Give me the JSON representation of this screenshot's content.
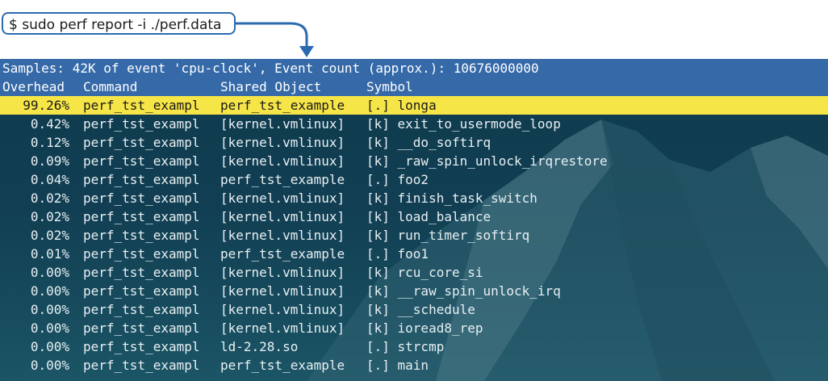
{
  "command": "$ sudo perf report -i ./perf.data",
  "summary": "Samples: 42K of event 'cpu-clock', Event count (approx.): 10676000000",
  "columns": {
    "overhead": "Overhead",
    "command": "Command",
    "object": "Shared Object",
    "symbol": "Symbol"
  },
  "colors": {
    "header_bg": "#3569a8",
    "selected_bg": "#f6e547",
    "arrow": "#2a6bb0",
    "terminal_bg": "#113e52"
  },
  "rows": [
    {
      "overhead": "99.26%",
      "command": "perf_tst_exampl",
      "object": "perf_tst_example",
      "symbol": "[.] longa",
      "selected": true
    },
    {
      "overhead": "0.42%",
      "command": "perf_tst_exampl",
      "object": "[kernel.vmlinux]",
      "symbol": "[k] exit_to_usermode_loop"
    },
    {
      "overhead": "0.12%",
      "command": "perf_tst_exampl",
      "object": "[kernel.vmlinux]",
      "symbol": "[k] __do_softirq"
    },
    {
      "overhead": "0.09%",
      "command": "perf_tst_exampl",
      "object": "[kernel.vmlinux]",
      "symbol": "[k] _raw_spin_unlock_irqrestore"
    },
    {
      "overhead": "0.04%",
      "command": "perf_tst_exampl",
      "object": "perf_tst_example",
      "symbol": "[.] foo2"
    },
    {
      "overhead": "0.02%",
      "command": "perf_tst_exampl",
      "object": "[kernel.vmlinux]",
      "symbol": "[k] finish_task_switch"
    },
    {
      "overhead": "0.02%",
      "command": "perf_tst_exampl",
      "object": "[kernel.vmlinux]",
      "symbol": "[k] load_balance"
    },
    {
      "overhead": "0.02%",
      "command": "perf_tst_exampl",
      "object": "[kernel.vmlinux]",
      "symbol": "[k] run_timer_softirq"
    },
    {
      "overhead": "0.01%",
      "command": "perf_tst_exampl",
      "object": "perf_tst_example",
      "symbol": "[.] foo1"
    },
    {
      "overhead": "0.00%",
      "command": "perf_tst_exampl",
      "object": "[kernel.vmlinux]",
      "symbol": "[k] rcu_core_si"
    },
    {
      "overhead": "0.00%",
      "command": "perf_tst_exampl",
      "object": "[kernel.vmlinux]",
      "symbol": "[k] __raw_spin_unlock_irq"
    },
    {
      "overhead": "0.00%",
      "command": "perf_tst_exampl",
      "object": "[kernel.vmlinux]",
      "symbol": "[k] __schedule"
    },
    {
      "overhead": "0.00%",
      "command": "perf_tst_exampl",
      "object": "[kernel.vmlinux]",
      "symbol": "[k] ioread8_rep"
    },
    {
      "overhead": "0.00%",
      "command": "perf_tst_exampl",
      "object": "ld-2.28.so",
      "symbol": "[.] strcmp"
    },
    {
      "overhead": "0.00%",
      "command": "perf_tst_exampl",
      "object": "perf_tst_example",
      "symbol": "[.] main"
    }
  ]
}
